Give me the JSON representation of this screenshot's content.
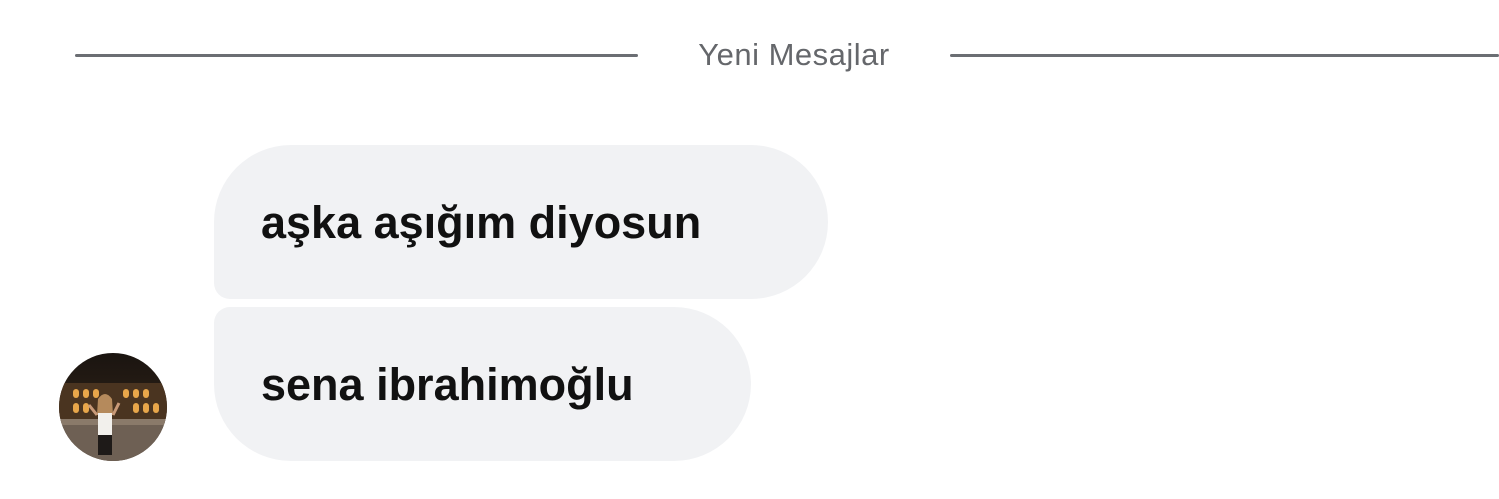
{
  "divider": {
    "label": "Yeni Mesajlar"
  },
  "messages": [
    {
      "text": "aşka aşığım diyosun"
    },
    {
      "text": "sena ibrahimoğlu"
    }
  ],
  "avatar": {
    "icon": "user-photo-avatar"
  },
  "colors": {
    "bubble_bg": "#f1f2f4",
    "divider": "#6b6e73",
    "divider_text": "#65676b",
    "message_text": "#111111"
  }
}
